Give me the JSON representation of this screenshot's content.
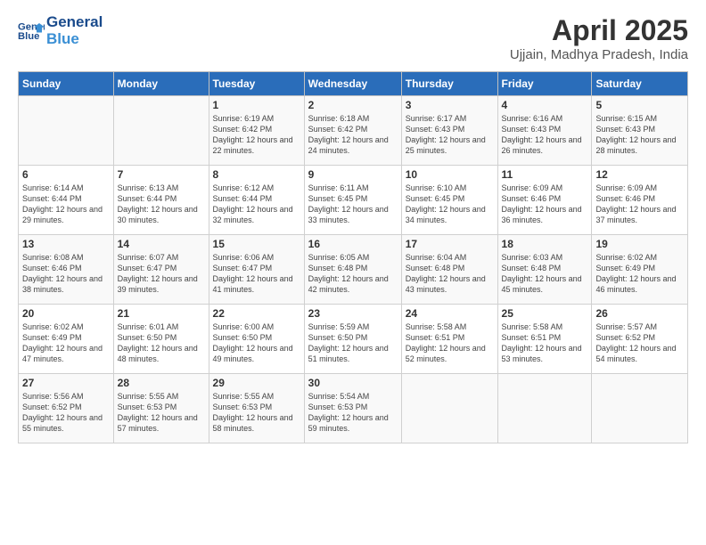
{
  "header": {
    "logo_line1": "General",
    "logo_line2": "Blue",
    "title": "April 2025",
    "location": "Ujjain, Madhya Pradesh, India"
  },
  "days_of_week": [
    "Sunday",
    "Monday",
    "Tuesday",
    "Wednesday",
    "Thursday",
    "Friday",
    "Saturday"
  ],
  "weeks": [
    [
      {
        "day": "",
        "text": ""
      },
      {
        "day": "",
        "text": ""
      },
      {
        "day": "1",
        "text": "Sunrise: 6:19 AM\nSunset: 6:42 PM\nDaylight: 12 hours and 22 minutes."
      },
      {
        "day": "2",
        "text": "Sunrise: 6:18 AM\nSunset: 6:42 PM\nDaylight: 12 hours and 24 minutes."
      },
      {
        "day": "3",
        "text": "Sunrise: 6:17 AM\nSunset: 6:43 PM\nDaylight: 12 hours and 25 minutes."
      },
      {
        "day": "4",
        "text": "Sunrise: 6:16 AM\nSunset: 6:43 PM\nDaylight: 12 hours and 26 minutes."
      },
      {
        "day": "5",
        "text": "Sunrise: 6:15 AM\nSunset: 6:43 PM\nDaylight: 12 hours and 28 minutes."
      }
    ],
    [
      {
        "day": "6",
        "text": "Sunrise: 6:14 AM\nSunset: 6:44 PM\nDaylight: 12 hours and 29 minutes."
      },
      {
        "day": "7",
        "text": "Sunrise: 6:13 AM\nSunset: 6:44 PM\nDaylight: 12 hours and 30 minutes."
      },
      {
        "day": "8",
        "text": "Sunrise: 6:12 AM\nSunset: 6:44 PM\nDaylight: 12 hours and 32 minutes."
      },
      {
        "day": "9",
        "text": "Sunrise: 6:11 AM\nSunset: 6:45 PM\nDaylight: 12 hours and 33 minutes."
      },
      {
        "day": "10",
        "text": "Sunrise: 6:10 AM\nSunset: 6:45 PM\nDaylight: 12 hours and 34 minutes."
      },
      {
        "day": "11",
        "text": "Sunrise: 6:09 AM\nSunset: 6:46 PM\nDaylight: 12 hours and 36 minutes."
      },
      {
        "day": "12",
        "text": "Sunrise: 6:09 AM\nSunset: 6:46 PM\nDaylight: 12 hours and 37 minutes."
      }
    ],
    [
      {
        "day": "13",
        "text": "Sunrise: 6:08 AM\nSunset: 6:46 PM\nDaylight: 12 hours and 38 minutes."
      },
      {
        "day": "14",
        "text": "Sunrise: 6:07 AM\nSunset: 6:47 PM\nDaylight: 12 hours and 39 minutes."
      },
      {
        "day": "15",
        "text": "Sunrise: 6:06 AM\nSunset: 6:47 PM\nDaylight: 12 hours and 41 minutes."
      },
      {
        "day": "16",
        "text": "Sunrise: 6:05 AM\nSunset: 6:48 PM\nDaylight: 12 hours and 42 minutes."
      },
      {
        "day": "17",
        "text": "Sunrise: 6:04 AM\nSunset: 6:48 PM\nDaylight: 12 hours and 43 minutes."
      },
      {
        "day": "18",
        "text": "Sunrise: 6:03 AM\nSunset: 6:48 PM\nDaylight: 12 hours and 45 minutes."
      },
      {
        "day": "19",
        "text": "Sunrise: 6:02 AM\nSunset: 6:49 PM\nDaylight: 12 hours and 46 minutes."
      }
    ],
    [
      {
        "day": "20",
        "text": "Sunrise: 6:02 AM\nSunset: 6:49 PM\nDaylight: 12 hours and 47 minutes."
      },
      {
        "day": "21",
        "text": "Sunrise: 6:01 AM\nSunset: 6:50 PM\nDaylight: 12 hours and 48 minutes."
      },
      {
        "day": "22",
        "text": "Sunrise: 6:00 AM\nSunset: 6:50 PM\nDaylight: 12 hours and 49 minutes."
      },
      {
        "day": "23",
        "text": "Sunrise: 5:59 AM\nSunset: 6:50 PM\nDaylight: 12 hours and 51 minutes."
      },
      {
        "day": "24",
        "text": "Sunrise: 5:58 AM\nSunset: 6:51 PM\nDaylight: 12 hours and 52 minutes."
      },
      {
        "day": "25",
        "text": "Sunrise: 5:58 AM\nSunset: 6:51 PM\nDaylight: 12 hours and 53 minutes."
      },
      {
        "day": "26",
        "text": "Sunrise: 5:57 AM\nSunset: 6:52 PM\nDaylight: 12 hours and 54 minutes."
      }
    ],
    [
      {
        "day": "27",
        "text": "Sunrise: 5:56 AM\nSunset: 6:52 PM\nDaylight: 12 hours and 55 minutes."
      },
      {
        "day": "28",
        "text": "Sunrise: 5:55 AM\nSunset: 6:53 PM\nDaylight: 12 hours and 57 minutes."
      },
      {
        "day": "29",
        "text": "Sunrise: 5:55 AM\nSunset: 6:53 PM\nDaylight: 12 hours and 58 minutes."
      },
      {
        "day": "30",
        "text": "Sunrise: 5:54 AM\nSunset: 6:53 PM\nDaylight: 12 hours and 59 minutes."
      },
      {
        "day": "",
        "text": ""
      },
      {
        "day": "",
        "text": ""
      },
      {
        "day": "",
        "text": ""
      }
    ]
  ]
}
